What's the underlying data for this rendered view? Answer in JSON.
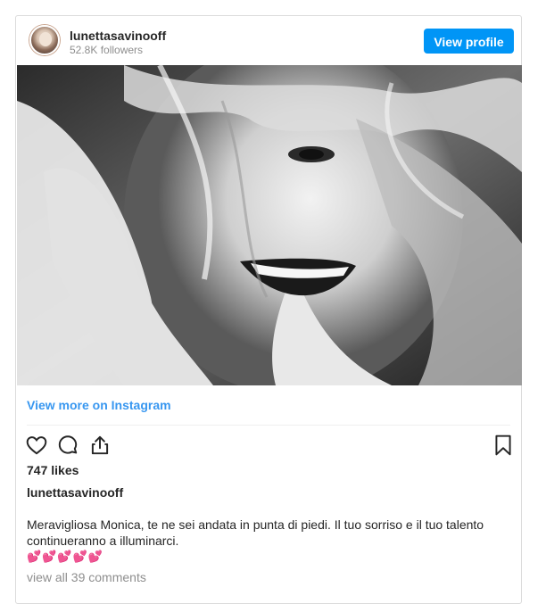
{
  "header": {
    "username": "lunettasavinooff",
    "followers": "52.8K followers",
    "view_profile_label": "View profile"
  },
  "post": {
    "image_alt": "Black and white close-up of a laughing woman with tousled hair, hands framing her face",
    "view_more_label": "View more on Instagram",
    "likes": "747 likes",
    "caption_user": "lunettasavinooff",
    "caption_text": "Meravigliosa Monica, te ne sei andata in punta di piedi. Il tuo sorriso e il tuo talento continueranno a illuminarci.",
    "caption_emojis": "💕💕💕💕💕",
    "comments_link": "view all 39 comments"
  },
  "actions": {
    "icons": [
      "heart-icon",
      "comment-icon",
      "share-icon",
      "bookmark-icon"
    ]
  },
  "colors": {
    "accent": "#0095f6",
    "link": "#3897f0",
    "text": "#262626",
    "muted": "#8e8e8e",
    "border": "#dbdbdb"
  }
}
